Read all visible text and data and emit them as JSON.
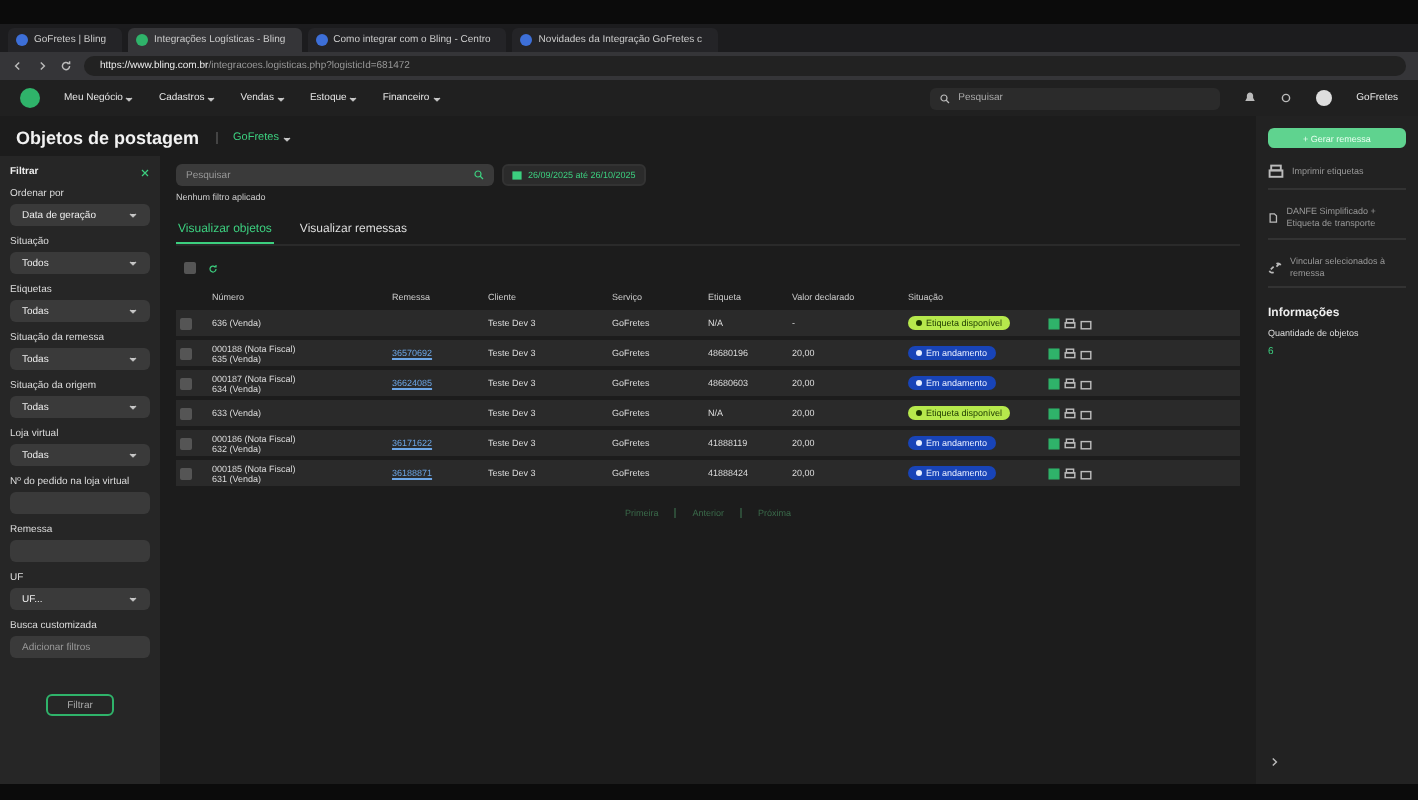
{
  "browser": {
    "tabs": [
      {
        "title": "GoFretes | Bling",
        "selected": false
      },
      {
        "title": "Integrações Logísticas - Bling",
        "selected": true
      },
      {
        "title": "Como integrar com o Bling - Centro",
        "selected": false
      },
      {
        "title": "Novidades da Integração GoFretes c",
        "selected": false
      }
    ],
    "url_host": "https://www.bling.com.br",
    "url_path": "/integracoes.logisticas.php?logisticId=681472"
  },
  "nav": {
    "menu": [
      "Meu Negócio",
      "Cadastros",
      "Vendas",
      "Estoque",
      "Financeiro"
    ],
    "search_placeholder": "Pesquisar",
    "user": "GoFretes"
  },
  "page": {
    "title": "Objetos de postagem",
    "integration": "GoFretes"
  },
  "filters": {
    "title": "Filtrar",
    "fields": [
      {
        "label": "Ordenar por",
        "kind": "select",
        "value": "Data de geração"
      },
      {
        "label": "Situação",
        "kind": "select",
        "value": "Todos"
      },
      {
        "label": "Etiquetas",
        "kind": "select",
        "value": "Todas"
      },
      {
        "label": "Situação da remessa",
        "kind": "select",
        "value": "Todas"
      },
      {
        "label": "Situação da origem",
        "kind": "select",
        "value": "Todas"
      },
      {
        "label": "Loja virtual",
        "kind": "select",
        "value": "Todas"
      },
      {
        "label": "Nº do pedido na loja virtual",
        "kind": "input"
      },
      {
        "label": "Remessa",
        "kind": "input"
      },
      {
        "label": "UF",
        "kind": "select",
        "value": "UF..."
      },
      {
        "label": "Busca customizada",
        "kind": "input",
        "placeholder": "Adicionar filtros"
      }
    ],
    "button": "Filtrar"
  },
  "search": {
    "placeholder": "Pesquisar",
    "date_range": "26/09/2025 até 26/10/2025",
    "no_filter": "Nenhum filtro aplicado"
  },
  "views": [
    {
      "label": "Visualizar objetos",
      "selected": true
    },
    {
      "label": "Visualizar remessas",
      "selected": false
    }
  ],
  "table": {
    "select_all_checked": false,
    "columns": [
      "Número",
      "Remessa",
      "Cliente",
      "Serviço",
      "Etiqueta",
      "Valor declarado",
      "Situação"
    ],
    "rows": [
      {
        "checked": false,
        "number": [
          "636 (Venda)"
        ],
        "remessa": "",
        "cliente": "Teste Dev 3",
        "servico": "GoFretes",
        "etiqueta": "N/A",
        "valor": "-",
        "status": {
          "label": "Etiqueta disponível",
          "kind": "available"
        }
      },
      {
        "checked": false,
        "number": [
          "000188 (Nota Fiscal)",
          "635 (Venda)"
        ],
        "remessa": "36570692",
        "cliente": "Teste Dev 3",
        "servico": "GoFretes",
        "etiqueta": "48680196",
        "valor": "20,00",
        "status": {
          "label": "Em andamento",
          "kind": "progress"
        }
      },
      {
        "checked": false,
        "number": [
          "000187 (Nota Fiscal)",
          "634 (Venda)"
        ],
        "remessa": "36624085",
        "cliente": "Teste Dev 3",
        "servico": "GoFretes",
        "etiqueta": "48680603",
        "valor": "20,00",
        "status": {
          "label": "Em andamento",
          "kind": "progress"
        }
      },
      {
        "checked": false,
        "number": [
          "633 (Venda)"
        ],
        "remessa": "",
        "cliente": "Teste Dev 3",
        "servico": "GoFretes",
        "etiqueta": "N/A",
        "valor": "20,00",
        "status": {
          "label": "Etiqueta disponível",
          "kind": "available"
        }
      },
      {
        "checked": false,
        "number": [
          "000186 (Nota Fiscal)",
          "632 (Venda)"
        ],
        "remessa": "36171622",
        "cliente": "Teste Dev 3",
        "servico": "GoFretes",
        "etiqueta": "41888119",
        "valor": "20,00",
        "status": {
          "label": "Em andamento",
          "kind": "progress"
        }
      },
      {
        "checked": false,
        "number": [
          "000185 (Nota Fiscal)",
          "631 (Venda)"
        ],
        "remessa": "36188871",
        "cliente": "Teste Dev 3",
        "servico": "GoFretes",
        "etiqueta": "41888424",
        "valor": "20,00",
        "status": {
          "label": "Em andamento",
          "kind": "progress"
        }
      }
    ]
  },
  "pagination": [
    "Primeira",
    "Anterior",
    "Próxima"
  ],
  "side": {
    "button": "+ Gerar remessa",
    "actions": [
      {
        "label": "Imprimir etiquetas",
        "kind": "print"
      },
      {
        "label": "DANFE Simplificado + Etiqueta de transporte",
        "kind": "doc"
      },
      {
        "label": "Vincular selecionados à remessa",
        "kind": "link"
      }
    ],
    "info_title": "Informações",
    "info_label": "Quantidade de objetos",
    "info_value": "6"
  }
}
